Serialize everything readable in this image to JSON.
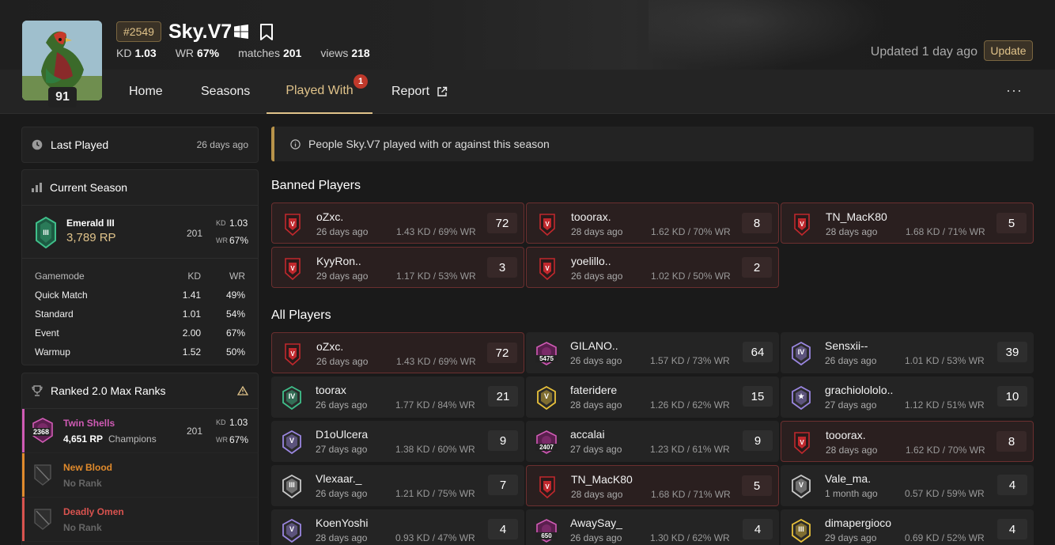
{
  "profile": {
    "rank_tag": "#2549",
    "username": "Sky.V7",
    "level": "91",
    "stats": [
      {
        "label": "KD",
        "value": "1.03"
      },
      {
        "label": "WR",
        "value": "67%"
      },
      {
        "label": "matches",
        "value": "201"
      },
      {
        "label": "views",
        "value": "218"
      }
    ],
    "updated": "Updated 1 day ago",
    "update_label": "Update"
  },
  "nav": {
    "tabs": [
      "Home",
      "Seasons",
      "Played With",
      "Report"
    ],
    "badge": "1",
    "more": "···"
  },
  "sidebar": {
    "last_played": {
      "title": "Last Played",
      "value": "26 days ago"
    },
    "current_season": {
      "title": "Current Season",
      "rank_name": "Emerald III",
      "rp": "3,789 RP",
      "matches": "201",
      "kd_label": "KD",
      "kd": "1.03",
      "wr_label": "WR",
      "wr": "67%",
      "table_headers": [
        "Gamemode",
        "KD",
        "WR"
      ],
      "modes": [
        {
          "name": "Quick Match",
          "kd": "1.41",
          "wr": "49%"
        },
        {
          "name": "Standard",
          "kd": "1.01",
          "wr": "54%"
        },
        {
          "name": "Event",
          "kd": "2.00",
          "wr": "67%"
        },
        {
          "name": "Warmup",
          "kd": "1.52",
          "wr": "50%"
        }
      ]
    },
    "max_ranks": {
      "title": "Ranked 2.0 Max Ranks",
      "entries": [
        {
          "season": "Twin Shells",
          "rp": "4,651 RP",
          "rank": "Champions",
          "badge": "2368",
          "matches": "201",
          "kd": "1.03",
          "wr": "67%",
          "color": "#d05bb5"
        },
        {
          "season": "New Blood",
          "rp": "No Rank",
          "color": "#e08a2c"
        },
        {
          "season": "Deadly Omen",
          "rp": "No Rank",
          "color": "#d9534f"
        }
      ]
    }
  },
  "main": {
    "info": "People Sky.V7 played with or against this season",
    "banned_title": "Banned Players",
    "all_title": "All Players",
    "banned": [
      {
        "name": "oZxc.",
        "time": "26 days ago",
        "stat": "1.43 KD / 69% WR",
        "count": "72"
      },
      {
        "name": "tooorax.",
        "time": "28 days ago",
        "stat": "1.62 KD / 70% WR",
        "count": "8"
      },
      {
        "name": "TN_MacK80",
        "time": "28 days ago",
        "stat": "1.68 KD / 71% WR",
        "count": "5"
      },
      {
        "name": "KyyRon..",
        "time": "29 days ago",
        "stat": "1.17 KD / 53% WR",
        "count": "3"
      },
      {
        "name": "yoelillo..",
        "time": "26 days ago",
        "stat": "1.02 KD / 50% WR",
        "count": "2"
      }
    ],
    "all": [
      {
        "name": "oZxc.",
        "time": "26 days ago",
        "stat": "1.43 KD / 69% WR",
        "count": "72",
        "banned": true,
        "icon": "banned",
        "badge": ""
      },
      {
        "name": "GILANO..",
        "time": "26 days ago",
        "stat": "1.57 KD / 73% WR",
        "count": "64",
        "icon": "champion",
        "badge": "5475"
      },
      {
        "name": "Sensxii--",
        "time": "26 days ago",
        "stat": "1.01 KD / 53% WR",
        "count": "39",
        "icon": "diamond",
        "badge": "IV"
      },
      {
        "name": "toorax",
        "time": "26 days ago",
        "stat": "1.77 KD / 84% WR",
        "count": "21",
        "icon": "emerald",
        "badge": "IV"
      },
      {
        "name": "fateridere",
        "time": "28 days ago",
        "stat": "1.26 KD / 62% WR",
        "count": "15",
        "icon": "gold",
        "badge": "V"
      },
      {
        "name": "grachiolololo..",
        "time": "27 days ago",
        "stat": "1.12 KD / 51% WR",
        "count": "10",
        "icon": "diamond",
        "badge": "★"
      },
      {
        "name": "D1oUlcera",
        "time": "27 days ago",
        "stat": "1.38 KD / 60% WR",
        "count": "9",
        "icon": "diamond",
        "badge": "V"
      },
      {
        "name": "accalai",
        "time": "27 days ago",
        "stat": "1.23 KD / 61% WR",
        "count": "9",
        "icon": "champion",
        "badge": "2407"
      },
      {
        "name": "tooorax.",
        "time": "28 days ago",
        "stat": "1.62 KD / 70% WR",
        "count": "8",
        "banned": true,
        "icon": "banned",
        "badge": ""
      },
      {
        "name": "Vlexaar._",
        "time": "26 days ago",
        "stat": "1.21 KD / 75% WR",
        "count": "7",
        "icon": "silver",
        "badge": "III"
      },
      {
        "name": "TN_MacK80",
        "time": "28 days ago",
        "stat": "1.68 KD / 71% WR",
        "count": "5",
        "banned": true,
        "icon": "banned",
        "badge": ""
      },
      {
        "name": "Vale_ma.",
        "time": "1 month ago",
        "stat": "0.57 KD / 59% WR",
        "count": "4",
        "icon": "silver",
        "badge": "V"
      },
      {
        "name": "KoenYoshi",
        "time": "28 days ago",
        "stat": "0.93 KD / 47% WR",
        "count": "4",
        "icon": "diamond",
        "badge": "V"
      },
      {
        "name": "AwaySay_",
        "time": "26 days ago",
        "stat": "1.30 KD / 62% WR",
        "count": "4",
        "icon": "champion",
        "badge": "650"
      },
      {
        "name": "dimapergioco",
        "time": "29 days ago",
        "stat": "0.69 KD / 52% WR",
        "count": "4",
        "icon": "gold",
        "badge": "III"
      }
    ]
  },
  "colors": {
    "accent": "#e0c38a",
    "banned_border": "#6b2f2f",
    "banned_icon": "#c0282d",
    "emerald": "#3fbf8a",
    "diamond": "#9a86e0",
    "champion": "#d05bb5",
    "gold": "#e8c13a",
    "silver": "#c8c8c8"
  }
}
